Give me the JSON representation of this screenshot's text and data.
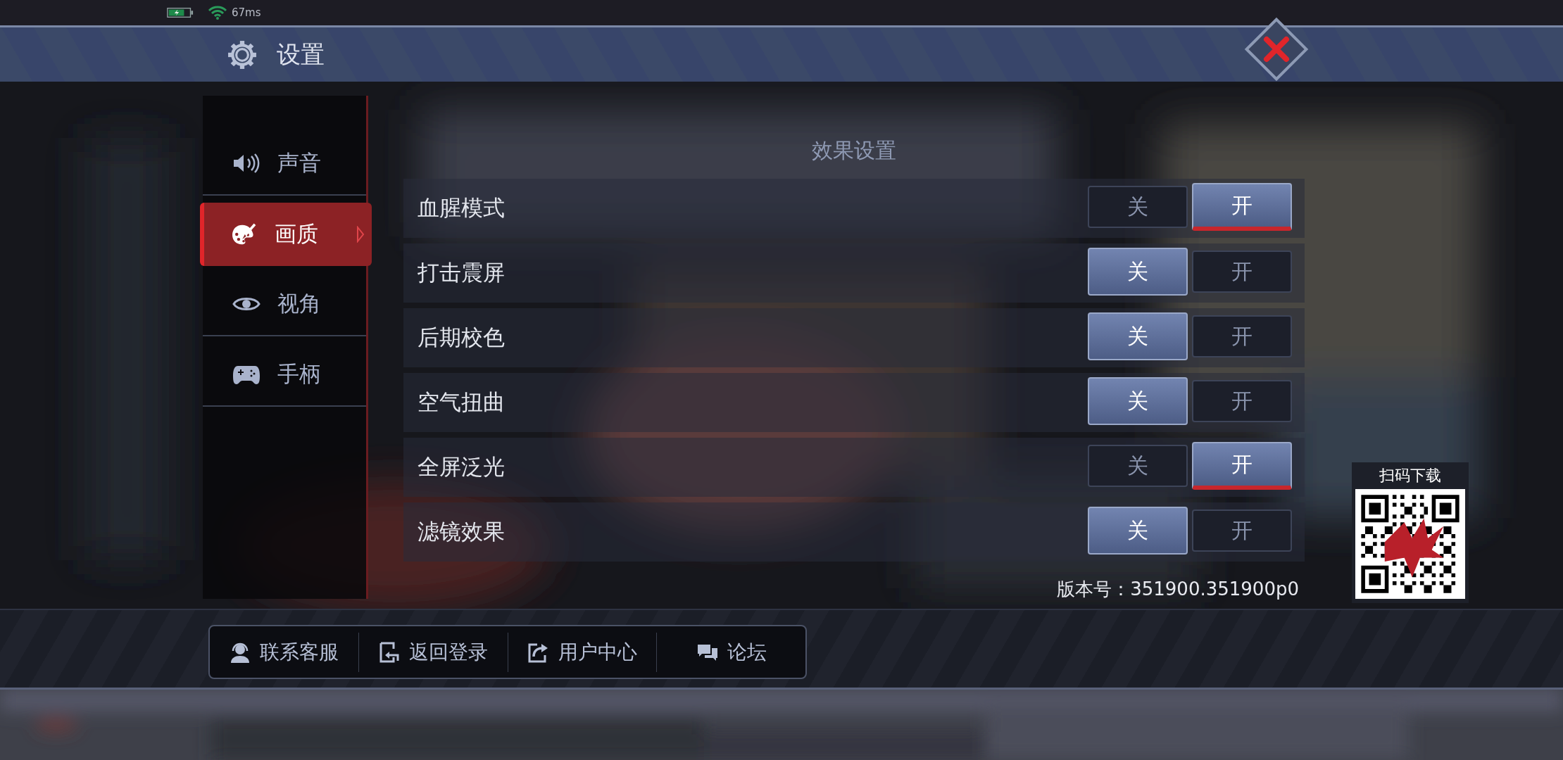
{
  "status_bar": {
    "ping": "67ms"
  },
  "header": {
    "title": "设置"
  },
  "sidebar": {
    "items": [
      {
        "label": "声音",
        "selected": false
      },
      {
        "label": "画质",
        "selected": true
      },
      {
        "label": "视角",
        "selected": false
      },
      {
        "label": "手柄",
        "selected": false
      }
    ]
  },
  "effects": {
    "title": "效果设置",
    "rows": [
      {
        "label": "血腥模式",
        "options": [
          {
            "label": "关",
            "selected": false
          },
          {
            "label": "开",
            "selected": true
          }
        ]
      },
      {
        "label": "打击震屏",
        "options": [
          {
            "label": "关",
            "selected": true
          },
          {
            "label": "开",
            "selected": false
          }
        ]
      },
      {
        "label": "后期校色",
        "options": [
          {
            "label": "关",
            "selected": true
          },
          {
            "label": "开",
            "selected": false
          }
        ]
      },
      {
        "label": "空气扭曲",
        "options": [
          {
            "label": "关",
            "selected": true
          },
          {
            "label": "开",
            "selected": false
          }
        ]
      },
      {
        "label": "全屏泛光",
        "options": [
          {
            "label": "关",
            "selected": false
          },
          {
            "label": "开",
            "selected": true
          }
        ]
      },
      {
        "label": "滤镜效果",
        "options": [
          {
            "label": "关",
            "selected": true
          },
          {
            "label": "开",
            "selected": false
          }
        ]
      }
    ]
  },
  "version": "版本号：351900.351900p0",
  "qr": {
    "caption": "扫码下载"
  },
  "footer": {
    "buttons": [
      {
        "label": "联系客服"
      },
      {
        "label": "返回登录"
      },
      {
        "label": "用户中心"
      },
      {
        "label": "论坛"
      }
    ]
  }
}
